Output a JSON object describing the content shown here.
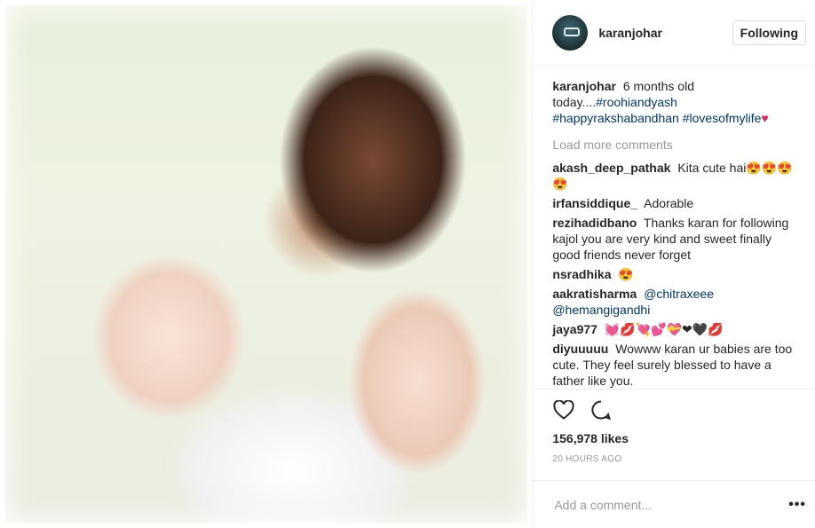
{
  "header": {
    "username": "karanjohar",
    "follow_label": "Following"
  },
  "caption": {
    "user": "karanjohar",
    "text": "6 months old today....",
    "tags": [
      "#roohiandyash",
      "#happyrakshabandhan",
      "#lovesofmylife"
    ],
    "emoji": "♥"
  },
  "load_more": "Load more comments",
  "comments": [
    {
      "user": "akash_deep_pathak",
      "text": "Kita cute hai",
      "emoji": "😍😍😍😍"
    },
    {
      "user": "irfansiddique_",
      "text": "Adorable",
      "emoji": ""
    },
    {
      "user": "rezihadidbano",
      "text": "Thanks karan for following kajol you are very kind and sweet finally good friends never forget",
      "emoji": ""
    },
    {
      "user": "nsradhika",
      "text": "",
      "emoji": "😍"
    },
    {
      "user": "aakratisharma",
      "text": "@chitraxeee @hemangigandhi",
      "emoji": ""
    },
    {
      "user": "jaya977",
      "text": "",
      "emoji": "💓💋💘💕💝❤🖤💋"
    },
    {
      "user": "diyuuuuu",
      "text": "Wowww karan ur babies are too cute. They feel surely blessed to have a father like you.",
      "emoji": ""
    }
  ],
  "likes": "156,978 likes",
  "timestamp": "20 HOURS AGO",
  "add_comment": {
    "placeholder": "Add a comment...",
    "more_label": "•••"
  },
  "icons": {
    "like": "heart-icon",
    "comment": "comment-icon"
  },
  "colors": {
    "link": "#003569",
    "muted": "#999999",
    "border": "#efefef"
  }
}
